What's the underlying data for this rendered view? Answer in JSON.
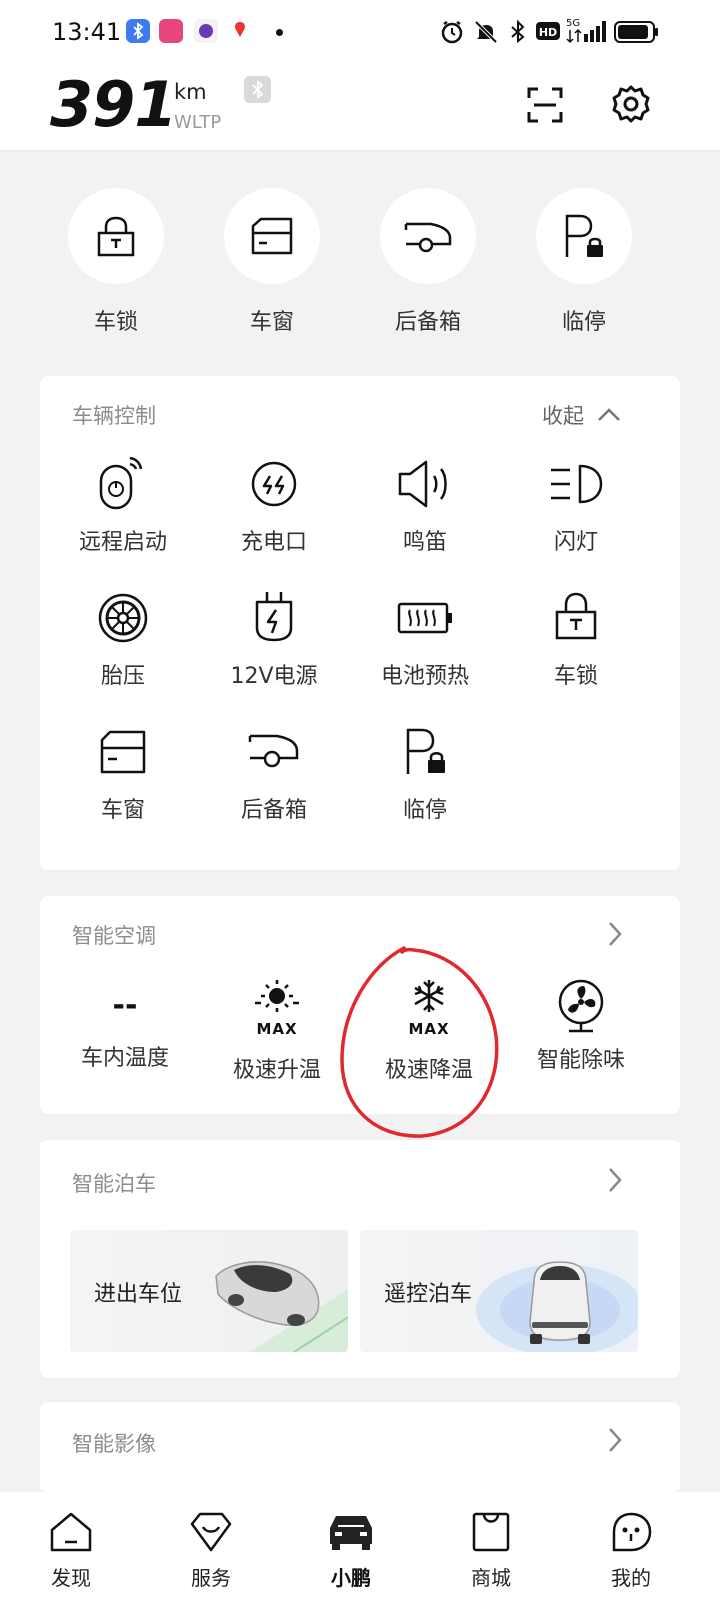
{
  "status_bar": {
    "time": "13:41"
  },
  "header": {
    "range_value": "391",
    "range_unit": "km",
    "range_standard": "WLTP"
  },
  "quick_actions": [
    {
      "label": "车锁",
      "icon": "lock-icon"
    },
    {
      "label": "车窗",
      "icon": "window-icon"
    },
    {
      "label": "后备箱",
      "icon": "trunk-icon"
    },
    {
      "label": "临停",
      "icon": "parking-lock-icon"
    }
  ],
  "vehicle_control": {
    "title": "车辆控制",
    "collapse_label": "收起",
    "items": [
      {
        "label": "远程启动",
        "icon": "remote-start-icon"
      },
      {
        "label": "充电口",
        "icon": "charge-port-icon"
      },
      {
        "label": "鸣笛",
        "icon": "horn-icon"
      },
      {
        "label": "闪灯",
        "icon": "headlight-icon"
      },
      {
        "label": "胎压",
        "icon": "tire-pressure-icon"
      },
      {
        "label": "12V电源",
        "icon": "power-12v-icon"
      },
      {
        "label": "电池预热",
        "icon": "battery-preheat-icon"
      },
      {
        "label": "车锁",
        "icon": "lock-icon"
      },
      {
        "label": "车窗",
        "icon": "window-icon"
      },
      {
        "label": "后备箱",
        "icon": "trunk-icon"
      },
      {
        "label": "临停",
        "icon": "parking-lock-icon"
      }
    ]
  },
  "climate": {
    "title": "智能空调",
    "items": [
      {
        "value": "--",
        "label": "车内温度"
      },
      {
        "icon_text": "MAX",
        "label": "极速升温",
        "icon": "sun-max-icon"
      },
      {
        "icon_text": "MAX",
        "label": "极速降温",
        "icon": "snowflake-max-icon"
      },
      {
        "label": "智能除味",
        "icon": "fan-icon"
      }
    ]
  },
  "parking": {
    "title": "智能泊车",
    "items": [
      {
        "label": "进出车位"
      },
      {
        "label": "遥控泊车"
      }
    ]
  },
  "imaging": {
    "title": "智能影像"
  },
  "bottom_nav": [
    {
      "label": "发现",
      "icon": "home-icon"
    },
    {
      "label": "服务",
      "icon": "service-icon"
    },
    {
      "label": "小鹏",
      "icon": "car-icon"
    },
    {
      "label": "商城",
      "icon": "shop-icon"
    },
    {
      "label": "我的",
      "icon": "profile-icon"
    }
  ],
  "colors": {
    "annotation_red": "#e0282e",
    "card_bg": "#ffffff",
    "page_bg": "#f2f2f3"
  }
}
